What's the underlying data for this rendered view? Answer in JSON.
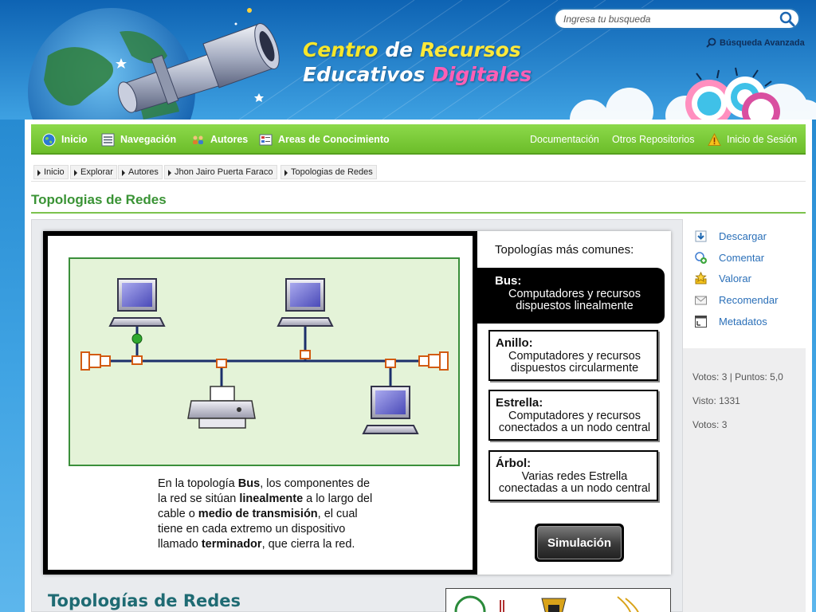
{
  "header": {
    "brand_line1": [
      "Centro",
      "de",
      "Recursos"
    ],
    "brand_line2": [
      "Educativos",
      "Digitales"
    ],
    "search_placeholder": "Ingresa tu busqueda",
    "advanced_search": "Búsqueda Avanzada"
  },
  "nav": {
    "left": [
      {
        "label": "Inicio",
        "icon": "globe-icon"
      },
      {
        "label": "Navegación",
        "icon": "list-icon"
      },
      {
        "label": "Autores",
        "icon": "people-icon"
      },
      {
        "label": "Areas de Conocimiento",
        "icon": "areas-icon"
      }
    ],
    "right": [
      {
        "label": "Documentación"
      },
      {
        "label": "Otros Repositorios"
      },
      {
        "label": "Inicio de Sesión",
        "icon": "warning-icon"
      }
    ]
  },
  "breadcrumb": [
    "Inicio",
    "Explorar",
    "Autores",
    "Jhon Jairo Puerta Faraco",
    "Topologias de Redes"
  ],
  "page_title": "Topologias de Redes",
  "resource": {
    "description_parts": [
      "En la topología ",
      "Bus",
      ", los componentes de la red se sitúan ",
      "linealmente",
      " a lo largo del cable o ",
      "medio de transmisión",
      ", el cual tiene en cada extremo un dispositivo llamado ",
      "terminador",
      ", que cierra la red."
    ],
    "common_title": "Topologías más comunes:",
    "topologies": [
      {
        "name": "Bus:",
        "desc": "Computadores y recursos dispuestos linealmente",
        "active": true
      },
      {
        "name": "Anillo:",
        "desc": "Computadores y recursos dispuestos circularmente",
        "active": false
      },
      {
        "name": "Estrella:",
        "desc": "Computadores y recursos conectados a un nodo central",
        "active": false
      },
      {
        "name": "Árbol:",
        "desc": "Varias redes Estrella conectadas a un nodo central",
        "active": false
      }
    ],
    "simulation_button": "Simulación",
    "next_title": "Topologías de Redes"
  },
  "sidebar": {
    "actions": [
      {
        "label": "Descargar",
        "icon": "download-icon"
      },
      {
        "label": "Comentar",
        "icon": "comment-icon"
      },
      {
        "label": "Valorar",
        "icon": "rate-icon"
      },
      {
        "label": "Recomendar",
        "icon": "email-icon"
      },
      {
        "label": "Metadatos",
        "icon": "metadata-icon"
      }
    ],
    "stats": {
      "votes_points": "Votos: 3 | Puntos: 5,0",
      "views": "Visto: 1331",
      "votes": "Votos: 3"
    }
  },
  "colors": {
    "nav_green": "#6cbd2a",
    "title_green": "#3a9335",
    "link_blue": "#2a6fb8",
    "header_blue": "#1b7fc9"
  }
}
